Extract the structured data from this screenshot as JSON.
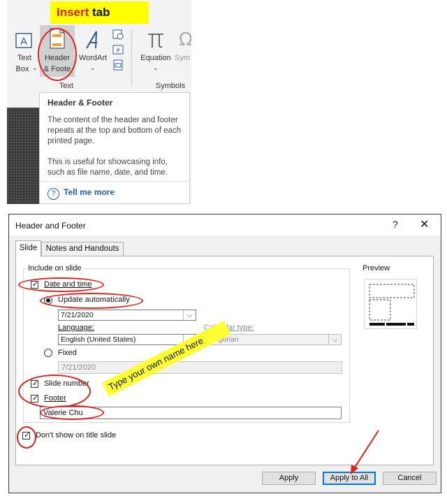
{
  "ribbon": {
    "insert_note": {
      "highlight": "Insert",
      "rest": " tab"
    },
    "text_box": {
      "line1": "Text",
      "line2": "Box"
    },
    "header_footer": {
      "line1": "Header",
      "line2": "& Foote"
    },
    "wordart": "WordArt",
    "equation": "Equation",
    "symbol_partial": "Sym",
    "group_text": "Text",
    "group_symbols": "Symbols"
  },
  "tooltip": {
    "title": "Header & Footer",
    "para1": "The content of the header and footer repeats at the top and bottom of each printed page.",
    "para2": "This is useful for showcasing info, such as file name, date, and time.",
    "help_link": "Tell me more"
  },
  "dialog": {
    "title": "Header and Footer",
    "help_glyph": "?",
    "close_glyph": "✕",
    "tabs": [
      "Slide",
      "Notes and Handouts"
    ],
    "group_label": "Include on slide",
    "preview_label": "Preview",
    "date_time": {
      "label": "Date and time",
      "checked": true
    },
    "update_auto": {
      "label": "Update automatically",
      "selected": true,
      "value": "7/21/2020"
    },
    "language": {
      "label": "Language:",
      "value": "English (United States)"
    },
    "calendar": {
      "label": "Calendar type:",
      "value": "Gregorian"
    },
    "fixed": {
      "label": "Fixed",
      "selected": false,
      "value": "7/21/2020"
    },
    "slide_number": {
      "label": "Slide number",
      "checked": true
    },
    "footer": {
      "label": "Footer",
      "checked": true,
      "value": "Valerie Chu"
    },
    "dont_show_title": {
      "label": "Don't show on title slide",
      "checked": true
    },
    "buttons": {
      "apply": "Apply",
      "apply_all": "Apply to All",
      "cancel": "Cancel"
    }
  },
  "annotations": {
    "type_note": "Type your own name here",
    "highlight_color": "#e0201a",
    "note_color": "#ffff33"
  }
}
